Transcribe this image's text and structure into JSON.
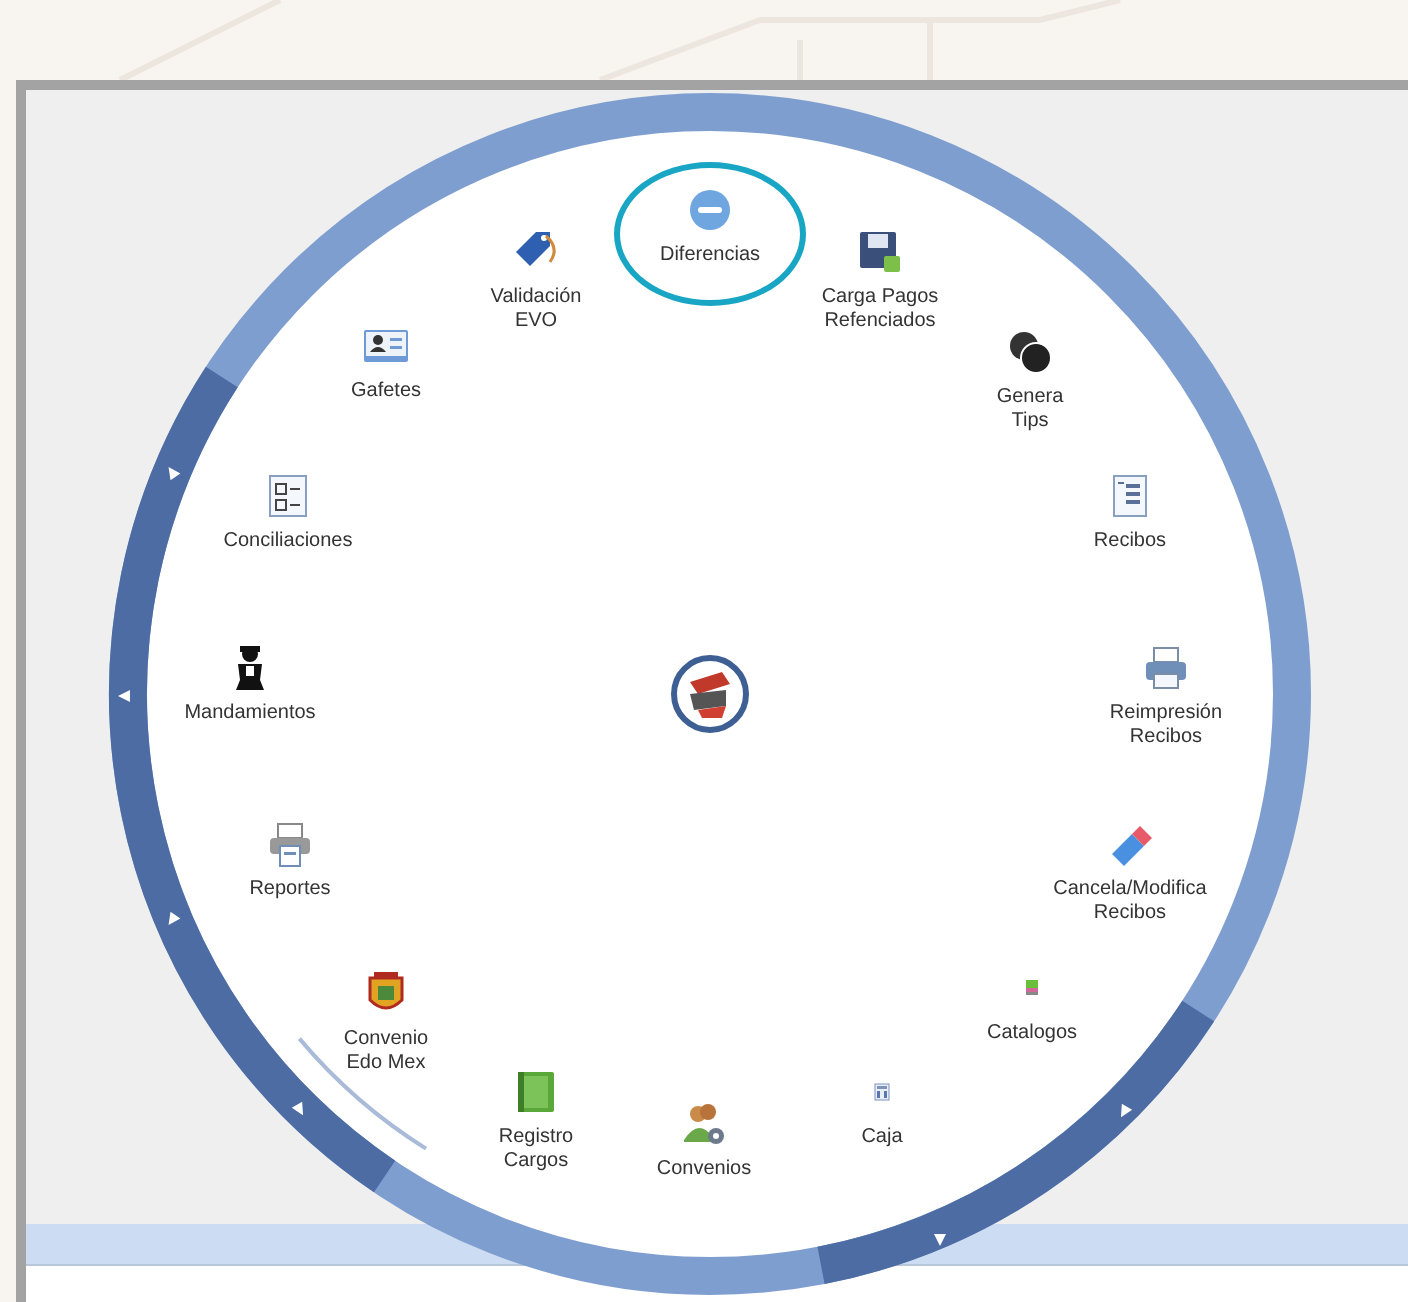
{
  "menu": {
    "items": [
      {
        "label": "Diferencias",
        "selected": true
      },
      {
        "label": "Validación\nEVO",
        "selected": false
      },
      {
        "label": "Carga Pagos\nRefenciados",
        "selected": false
      },
      {
        "label": "Gafetes",
        "selected": false
      },
      {
        "label": "Genera\nTips",
        "selected": false
      },
      {
        "label": "Conciliaciones",
        "selected": false
      },
      {
        "label": "Recibos",
        "selected": false
      },
      {
        "label": "Mandamientos",
        "selected": false
      },
      {
        "label": "Reimpresión\nRecibos",
        "selected": false
      },
      {
        "label": "Reportes",
        "selected": false
      },
      {
        "label": "Cancela/Modifica\nRecibos",
        "selected": false
      },
      {
        "label": "Convenio\nEdo Mex",
        "selected": false
      },
      {
        "label": "Catalogos",
        "selected": false
      },
      {
        "label": "Registro\nCargos",
        "selected": false
      },
      {
        "label": "Caja",
        "selected": false
      },
      {
        "label": "Convenios",
        "selected": false
      }
    ]
  }
}
